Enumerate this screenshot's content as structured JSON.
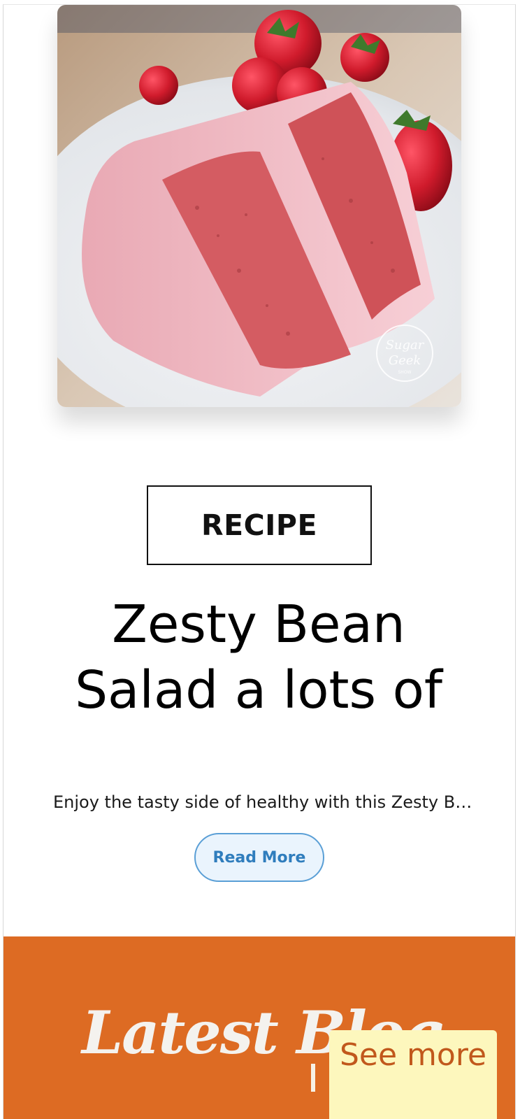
{
  "post": {
    "image_alt": "Slice of strawberry layer cake with pink frosting and fresh strawberries",
    "image_watermark": "Sugar Geek Show",
    "category": "RECIPE",
    "title": "Zesty Bean Salad a lots of",
    "excerpt": "Enjoy the tasty side of healthy with this Zesty Bean Salad loaded with flavor",
    "read_more_label": "Read More"
  },
  "latest_section": {
    "heading": "Latest Blog",
    "see_more_label": "See more"
  },
  "colors": {
    "accent_orange": "#dd6b23",
    "read_more_blue": "#2f7dbd",
    "see_more_bg": "#fdf7bd",
    "see_more_text": "#c1581c"
  }
}
